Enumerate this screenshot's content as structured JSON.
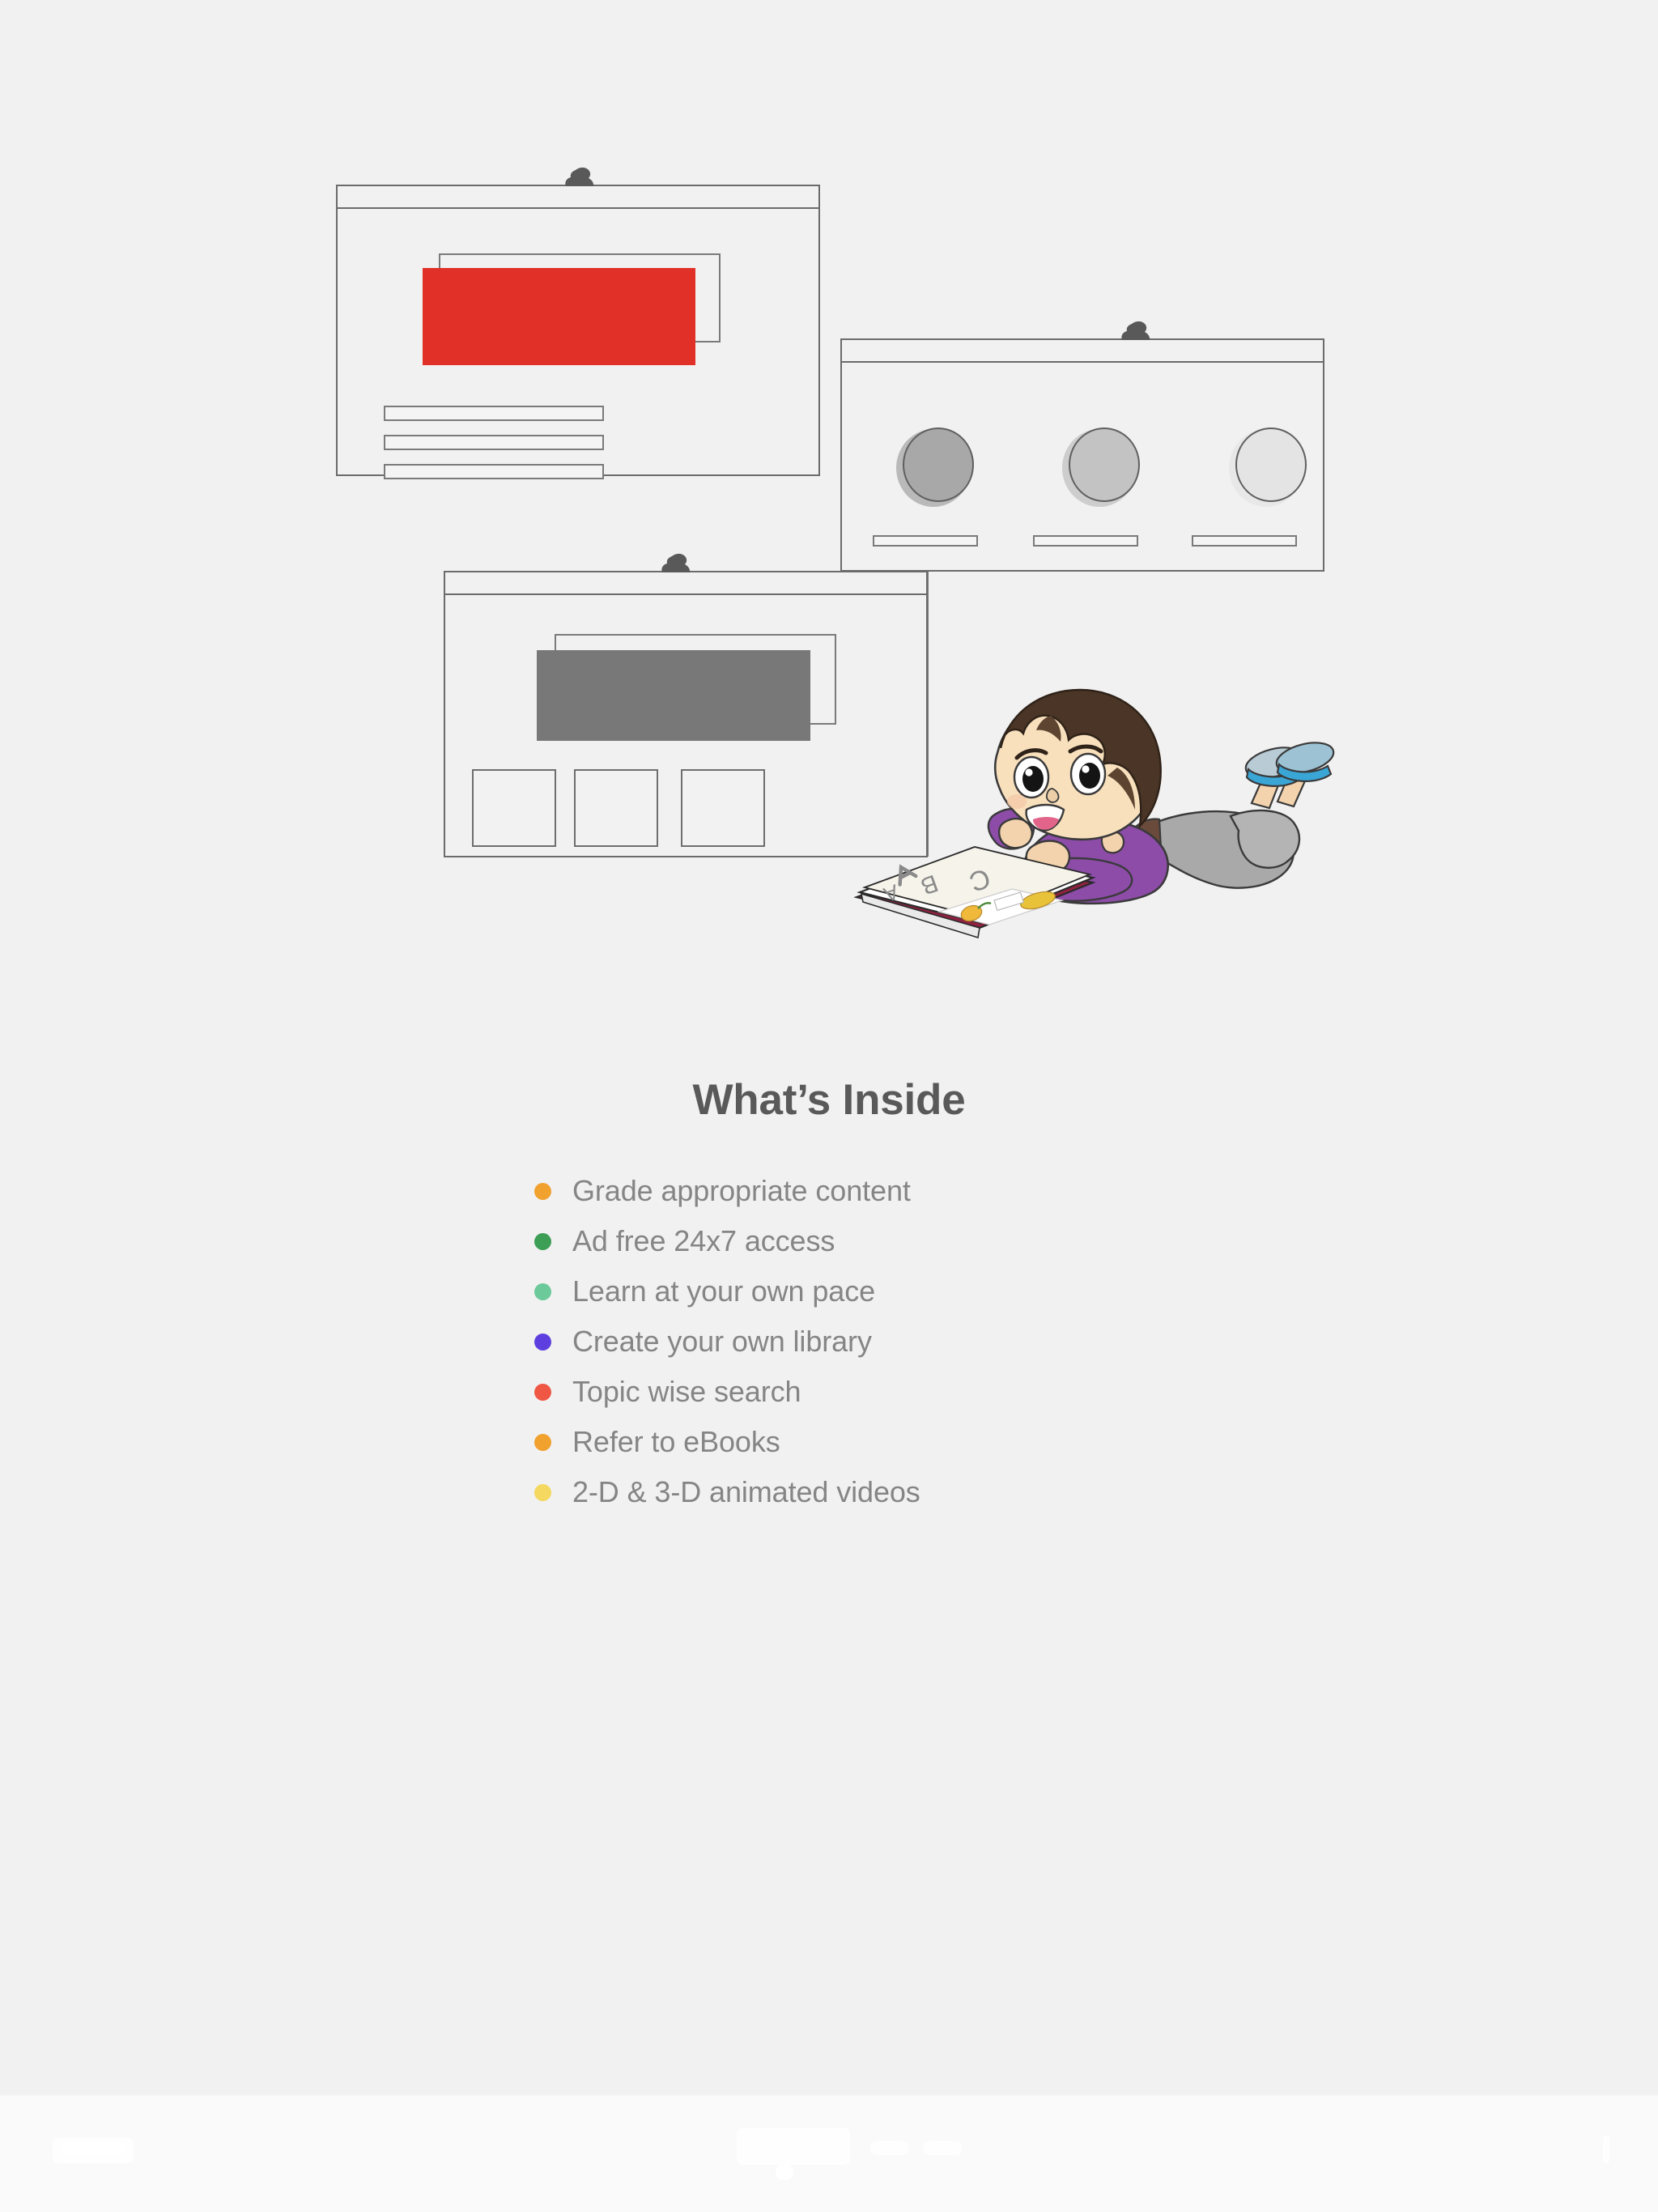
{
  "background_color": "#f1f1f1",
  "heading": {
    "title": "What’s Inside",
    "color": "#595959"
  },
  "features": [
    {
      "label": "Grade appropriate content",
      "dot_color": "#f0a12e"
    },
    {
      "label": "Ad free 24x7 access",
      "dot_color": "#3d9e56"
    },
    {
      "label": "Learn at your own pace",
      "dot_color": "#6cc99a"
    },
    {
      "label": "Create your own library",
      "dot_color": "#5d3fe0"
    },
    {
      "label": "Topic wise search",
      "dot_color": "#ef5644"
    },
    {
      "label": "Refer to eBooks",
      "dot_color": "#f0a12e"
    },
    {
      "label": "2-D & 3-D animated videos",
      "dot_color": "#f5d860"
    }
  ],
  "illustration": {
    "alt": "Child lying on floor reading an ABC picture book beside three pinned wireframe cards",
    "card_border_color": "#6b6b6b",
    "cards": [
      {
        "name": "hero-card",
        "pin": "pushpin-icon",
        "accent_color": "#e03027",
        "text_line_count": 3
      },
      {
        "name": "avatars-card",
        "pin": "pushpin-icon",
        "avatar_colors": [
          "#a8a8a8",
          "#c3c3c3",
          "#e4e4e4"
        ],
        "caption_count": 3
      },
      {
        "name": "gallery-card",
        "pin": "pushpin-icon",
        "banner_color": "#787878",
        "thumbnail_count": 3
      }
    ],
    "child": {
      "hair_color": "#4a3526",
      "shirt_color": "#8c4ca8",
      "pants_color": "#a9a9a9",
      "shoe_color": "#3aa6d6",
      "book_letters": "A B C",
      "book_spine_color": "#8e2240"
    }
  }
}
